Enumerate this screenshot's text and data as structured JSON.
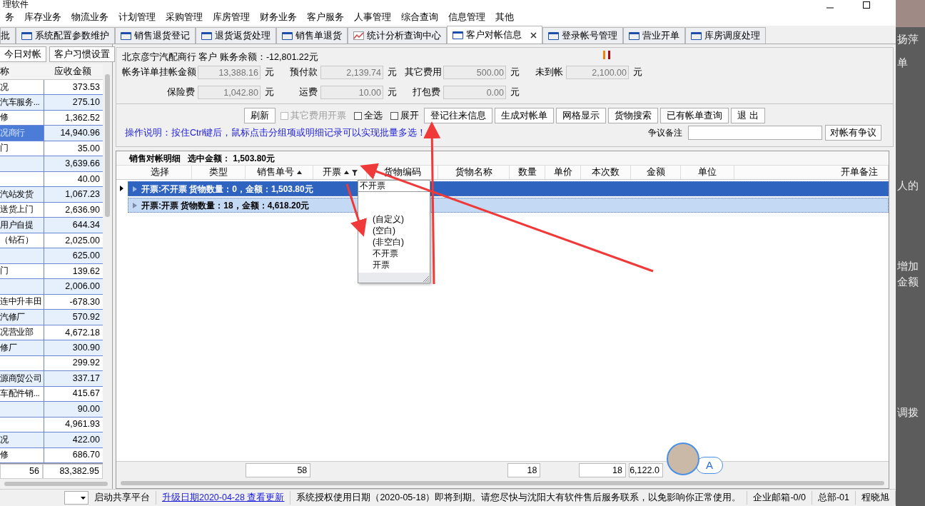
{
  "window": {
    "title": "理软件"
  },
  "menu": [
    "务",
    "库存业务",
    "物流业务",
    "计划管理",
    "采购管理",
    "库房管理",
    "财务业务",
    "客户服务",
    "人事管理",
    "综合查询",
    "信息管理",
    "其他"
  ],
  "tabs": [
    {
      "label": "批",
      "kind": "plain",
      "selected": false,
      "closable": false
    },
    {
      "label": "系统配置参数维护",
      "kind": "window",
      "selected": false,
      "closable": false
    },
    {
      "label": "销售退货登记",
      "kind": "window",
      "selected": false,
      "closable": false
    },
    {
      "label": "退货返货处理",
      "kind": "window",
      "selected": false,
      "closable": false
    },
    {
      "label": "销售单退货",
      "kind": "window",
      "selected": false,
      "closable": false
    },
    {
      "label": "统计分析查询中心",
      "kind": "chart",
      "selected": false,
      "closable": false
    },
    {
      "label": "客户对帐信息",
      "kind": "window",
      "selected": true,
      "closable": true
    },
    {
      "label": "登录帐号管理",
      "kind": "window",
      "selected": false,
      "closable": false
    },
    {
      "label": "营业开单",
      "kind": "window",
      "selected": false,
      "closable": false
    },
    {
      "label": "库房调度处理",
      "kind": "window",
      "selected": false,
      "closable": false
    }
  ],
  "left_panel": {
    "buttons": [
      "今日对帐",
      "客户习惯设置"
    ],
    "columns": [
      "称",
      "应收金额"
    ],
    "rows": [
      {
        "name": "况",
        "amount": "373.53",
        "selected": false
      },
      {
        "name": "汽车服务...",
        "amount": "275.10",
        "selected": false
      },
      {
        "name": "修",
        "amount": "1,362.52",
        "selected": false
      },
      {
        "name": "况商行",
        "amount": "14,940.96",
        "selected": true
      },
      {
        "name": "门",
        "amount": "35.00",
        "selected": false
      },
      {
        "name": "",
        "amount": "3,639.66",
        "selected": false
      },
      {
        "name": "",
        "amount": "40.00",
        "selected": false
      },
      {
        "name": "汽站发货",
        "amount": "1,067.23",
        "selected": false
      },
      {
        "name": "送货上门",
        "amount": "2,636.90",
        "selected": false
      },
      {
        "name": "用户自提",
        "amount": "644.34",
        "selected": false
      },
      {
        "name": "（钻石）",
        "amount": "2,025.00",
        "selected": false
      },
      {
        "name": "",
        "amount": "625.00",
        "selected": false
      },
      {
        "name": "门",
        "amount": "139.62",
        "selected": false
      },
      {
        "name": "",
        "amount": "2,006.00",
        "selected": false
      },
      {
        "name": "连中升丰田",
        "amount": "-678.30",
        "selected": false
      },
      {
        "name": "汽修厂",
        "amount": "570.92",
        "selected": false
      },
      {
        "name": "况营业部",
        "amount": "4,672.18",
        "selected": false
      },
      {
        "name": "修厂",
        "amount": "300.90",
        "selected": false
      },
      {
        "name": "",
        "amount": "299.92",
        "selected": false
      },
      {
        "name": "源商贸公司",
        "amount": "337.17",
        "selected": false
      },
      {
        "name": "车配件销...",
        "amount": "415.67",
        "selected": false
      },
      {
        "name": "",
        "amount": "90.00",
        "selected": false
      },
      {
        "name": "",
        "amount": "4,961.93",
        "selected": false
      },
      {
        "name": "况",
        "amount": "422.00",
        "selected": false
      },
      {
        "name": "修",
        "amount": "686.70",
        "selected": false
      }
    ],
    "footer": {
      "count": "56",
      "total": "83,382.95"
    }
  },
  "account": {
    "summary": "北京彦宁汽配商行  客户 账务余额：-12,801.22元",
    "details_label": "帐务详单",
    "fields": [
      [
        {
          "label": "挂帐金额",
          "value": "13,388.16",
          "unit": "元"
        },
        {
          "label": "预付款",
          "value": "2,139.74",
          "unit": "元"
        },
        {
          "label": "其它费用",
          "value": "500.00",
          "unit": "元"
        },
        {
          "label": "未到帐",
          "value": "2,100.00",
          "unit": "元"
        }
      ],
      [
        {
          "label": "保险费",
          "value": "1,042.80",
          "unit": "元"
        },
        {
          "label": "运费",
          "value": "10.00",
          "unit": "元"
        },
        {
          "label": "打包费",
          "value": "0.00",
          "unit": "元"
        }
      ]
    ]
  },
  "toolbar": [
    {
      "kind": "button",
      "label": "刷新"
    },
    {
      "kind": "checkbox",
      "label": "其它费用开票",
      "checked": false,
      "disabled": true
    },
    {
      "kind": "checkbox",
      "label": "全选",
      "checked": false,
      "disabled": false
    },
    {
      "kind": "checkbox",
      "label": "展开",
      "checked": false,
      "disabled": false
    },
    {
      "kind": "button",
      "label": "登记往来信息"
    },
    {
      "kind": "button",
      "label": "生成对帐单"
    },
    {
      "kind": "button",
      "label": "网格显示"
    },
    {
      "kind": "button",
      "label": "货物搜索"
    },
    {
      "kind": "button",
      "label": "已有帐单查询"
    },
    {
      "kind": "button",
      "label": "退 出"
    }
  ],
  "instructions": "操作说明：按住Ctrl键后，鼠标点击分组项或明细记录可以实现批量多选！",
  "dispute": {
    "label": "争议备注",
    "button": "对帐有争议"
  },
  "grid": {
    "title": "销售对帐明细",
    "selected_total": "选中金额：  1,503.80元",
    "columns": [
      {
        "label": "选择",
        "sorted": false,
        "filter": false
      },
      {
        "label": "类型",
        "sorted": false,
        "filter": false
      },
      {
        "label": "销售单号",
        "sorted": true,
        "filter": false,
        "sum": "58"
      },
      {
        "label": "开票",
        "sorted": true,
        "filter": true
      },
      {
        "label": "货物编码",
        "sorted": false,
        "filter": false
      },
      {
        "label": "货物名称",
        "sorted": false,
        "filter": false
      },
      {
        "label": "数量",
        "sorted": false,
        "filter": false,
        "sum": "18"
      },
      {
        "label": "单价",
        "sorted": false,
        "filter": false
      },
      {
        "label": "本次数",
        "sorted": false,
        "filter": false,
        "sum": "18"
      },
      {
        "label": "金额",
        "sorted": false,
        "filter": false,
        "sum": "6,122.0"
      },
      {
        "label": "单位",
        "sorted": false,
        "filter": false
      },
      {
        "label": "开单备注",
        "sorted": false,
        "filter": false
      }
    ],
    "groups": [
      {
        "text": "开票:不开票 货物数量：0，金额：1,503.80元",
        "selected": true
      },
      {
        "text": "开票:开票 货物数量：18，金额：4,618.20元",
        "selected": false
      }
    ],
    "filter_dropdown": {
      "search": "不开票",
      "options": [
        "(自定义)",
        "(空白)",
        "(非空白)",
        "不开票",
        "开票"
      ]
    }
  },
  "chat_bubble": "A",
  "status_bar": {
    "platform": "启动共享平台",
    "update_link": "升级日期2020-04-28 查看更新",
    "notice": "系统授权使用日期（2020-05-18）即将到期。请您尽快与沈阳大有软件售后服务联系，以免影响你正常使用。",
    "mail": "企业邮箱-0/0",
    "branch": "总部-01",
    "user": "程晓旭"
  },
  "side_window": [
    "扬萍",
    "单",
    "人的",
    "增加",
    "金额",
    "调拨"
  ]
}
